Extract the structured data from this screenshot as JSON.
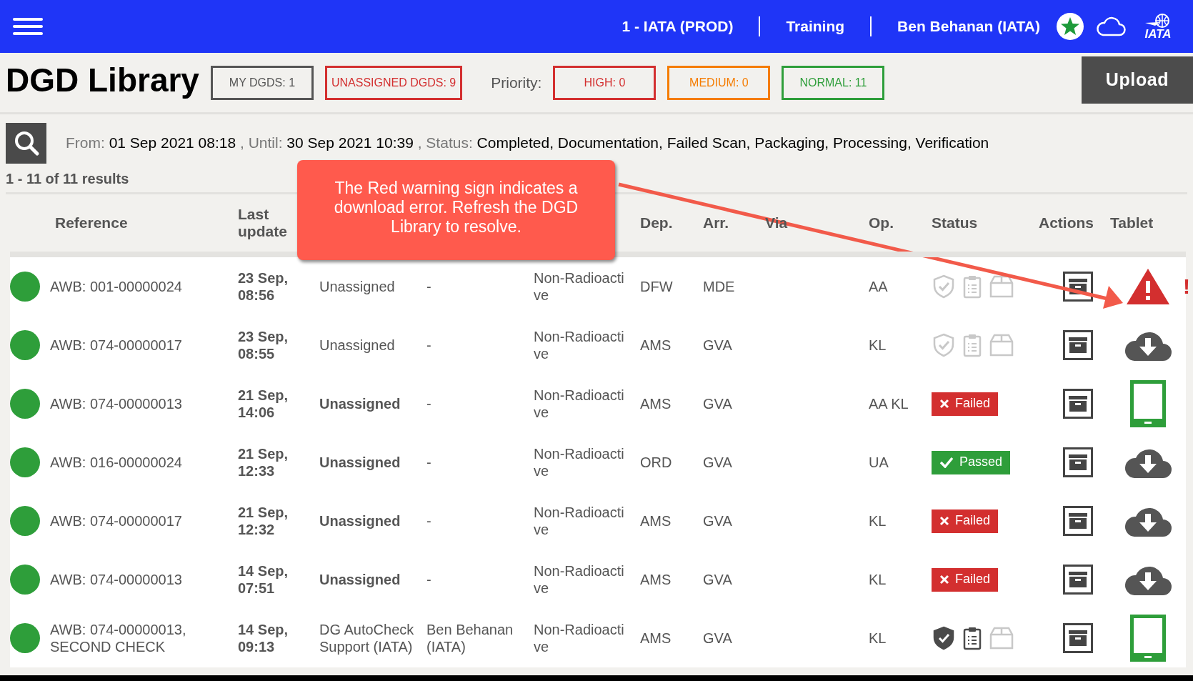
{
  "header": {
    "items": [
      "1 - IATA (PROD)",
      "Training",
      "Ben Behanan (IATA)"
    ],
    "logo_text": "IATA"
  },
  "title": "DGD Library",
  "counters": [
    {
      "label": "MY DGDS: 1",
      "color": "#555555"
    },
    {
      "label": "UNASSIGNED DGDS: 9",
      "color": "#d32f2f"
    }
  ],
  "priority_label": "Priority:",
  "priorities": [
    {
      "label": "HIGH: 0",
      "color": "#d32f2f"
    },
    {
      "label": "MEDIUM: 0",
      "color": "#f57c00"
    },
    {
      "label": "NORMAL: 11",
      "color": "#2e9e3a"
    }
  ],
  "upload_button": "Upload",
  "filters": [
    {
      "label": "From:",
      "value": "01 Sep 2021 08:18"
    },
    {
      "label": ", Until:",
      "value": "30 Sep 2021 10:39"
    },
    {
      "label": ", Status:",
      "value": "Completed, Documentation, Failed Scan, Packaging, Processing, Verification"
    }
  ],
  "results": "1 - 11 of 11 results",
  "callout": "The Red warning sign indicates a download error. Refresh the DGD Library to resolve.",
  "table": {
    "columns": [
      {},
      {
        "label": "Reference"
      },
      {
        "label": "Last update"
      },
      {},
      {},
      {},
      {
        "label": "Dep."
      },
      {
        "label": "Arr."
      },
      {
        "label": "Via"
      },
      {
        "label": "Op."
      },
      {
        "label": "Status"
      },
      {
        "label": "Actions"
      },
      {
        "label": "Tablet"
      }
    ],
    "rows": [
      {
        "color": "#2e9e3a",
        "reference": "AWB: 001-00000024",
        "date": "23 Sep,",
        "time": "08:56",
        "assigned": "Unassigned",
        "bold": false,
        "assignee": "-",
        "type": "Non-Radioactive",
        "dep": "DFW",
        "arr": "MDE",
        "op": "AA",
        "status": {
          "kind": "steps",
          "steps": [
            {
              "done": false
            },
            {
              "done": false
            },
            {
              "done": false
            }
          ]
        },
        "tablet": {
          "kind": "warning",
          "flag": "!"
        }
      },
      {
        "color": "#2e9e3a",
        "reference": "AWB: 074-00000017",
        "date": "23 Sep,",
        "time": "08:55",
        "assigned": "Unassigned",
        "bold": false,
        "assignee": "-",
        "type": "Non-Radioactive",
        "dep": "AMS",
        "arr": "GVA",
        "op": "KL",
        "status": {
          "kind": "steps",
          "steps": [
            {
              "done": false
            },
            {
              "done": false
            },
            {
              "done": false
            }
          ]
        },
        "tablet": {
          "kind": "download"
        }
      },
      {
        "color": "#2e9e3a",
        "reference": "AWB: 074-00000013",
        "date": "21 Sep,",
        "time": "14:06",
        "assigned": "Unassigned",
        "bold": true,
        "assignee": "-",
        "type": "Non-Radioactive",
        "dep": "AMS",
        "arr": "GVA",
        "op": "AA KL",
        "status": {
          "kind": "badge",
          "label": "Failed",
          "passed": false
        },
        "tablet": {
          "kind": "tablet"
        }
      },
      {
        "color": "#2e9e3a",
        "reference": "AWB: 016-00000024",
        "date": "21 Sep,",
        "time": "12:33",
        "assigned": "Unassigned",
        "bold": true,
        "assignee": "-",
        "type": "Non-Radioactive",
        "dep": "ORD",
        "arr": "GVA",
        "op": "UA",
        "status": {
          "kind": "badge",
          "label": "Passed",
          "passed": true
        },
        "tablet": {
          "kind": "download"
        }
      },
      {
        "color": "#2e9e3a",
        "reference": "AWB: 074-00000017",
        "date": "21 Sep,",
        "time": "12:32",
        "assigned": "Unassigned",
        "bold": true,
        "assignee": "-",
        "type": "Non-Radioactive",
        "dep": "AMS",
        "arr": "GVA",
        "op": "KL",
        "status": {
          "kind": "badge",
          "label": "Failed",
          "passed": false
        },
        "tablet": {
          "kind": "download"
        }
      },
      {
        "color": "#2e9e3a",
        "reference": "AWB: 074-00000013",
        "date": "14 Sep,",
        "time": "07:51",
        "assigned": "Unassigned",
        "bold": true,
        "assignee": "-",
        "type": "Non-Radioactive",
        "dep": "AMS",
        "arr": "GVA",
        "op": "KL",
        "status": {
          "kind": "badge",
          "label": "Failed",
          "passed": false
        },
        "tablet": {
          "kind": "download"
        }
      },
      {
        "color": "#2e9e3a",
        "reference": "AWB: 074-00000013, SECOND CHECK",
        "date": "14 Sep,",
        "time": "09:13",
        "assigned": "DG AutoCheck Support (IATA)",
        "bold": false,
        "assignee": "Ben Behanan (IATA)",
        "type": "Non-Radioactive",
        "dep": "AMS",
        "arr": "GVA",
        "op": "KL",
        "status": {
          "kind": "steps",
          "steps": [
            {
              "done": true
            },
            {
              "done": true
            },
            {
              "done": false
            }
          ]
        },
        "tablet": {
          "kind": "tablet"
        }
      }
    ]
  }
}
